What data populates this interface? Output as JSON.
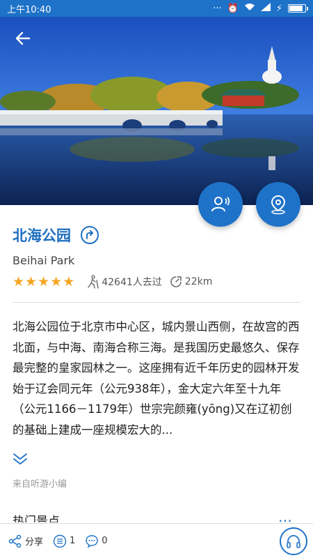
{
  "status_bar": {
    "time": "上午10:40",
    "battery_level": 0.9
  },
  "attraction": {
    "name": "北海公园",
    "name_en": "Beihai Park",
    "rating": 5,
    "visitors": "42641人去过",
    "distance": "22km",
    "description": "北海公园位于北京市中心区，城内景山西侧，在故宫的西北面，与中海、南海合称三海。是我国历史最悠久、保存最完整的皇家园林之一。这座拥有近千年历史的园林开发始于辽会同元年（公元938年），金大定六年至十九年（公元1166－1179年）世宗完颜雍(yōng)又在辽初创的基础上建成一座规模宏大的...",
    "source": "来自听游小编"
  },
  "sections": {
    "hot_spots_title": "热门景点",
    "more": "…"
  },
  "bottom_bar": {
    "share_label": "分享",
    "list_count": "1",
    "comment_count": "0"
  },
  "icons": {
    "back": "arrow-left-icon",
    "guide": "person-speaking-icon",
    "location": "location-pin-icon",
    "share_route": "share-arrow-icon",
    "star": "star-icon",
    "hiker": "hiker-icon",
    "distance": "distance-icon",
    "expand": "chevron-double-down-icon",
    "share": "share-icon",
    "list": "list-icon",
    "comment": "comment-icon",
    "audio": "headphones-icon"
  },
  "colors": {
    "primary": "#1e72c8",
    "title": "#1e6fc0",
    "star": "#f5a623"
  }
}
